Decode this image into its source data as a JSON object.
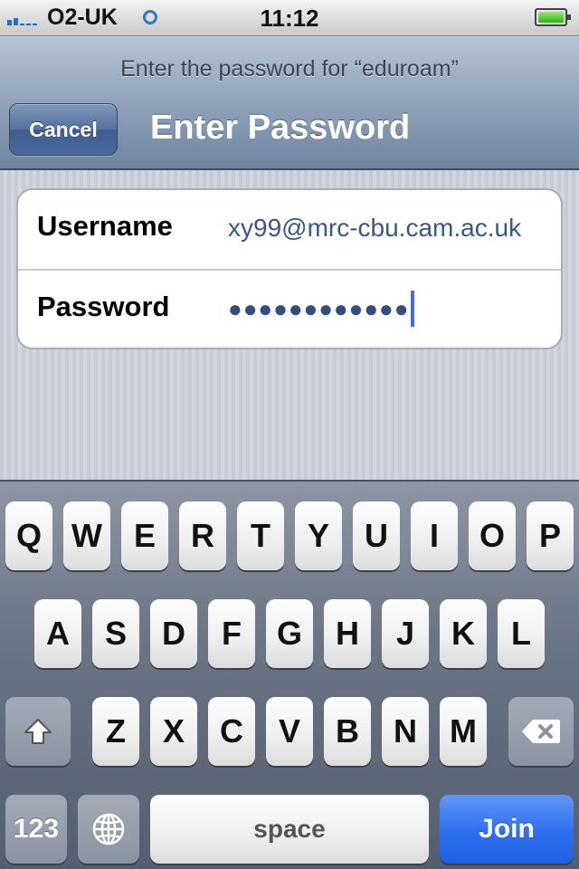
{
  "status_bar": {
    "carrier": "O2-UK",
    "time": "11:12",
    "signal_icon": "signal-bars-icon",
    "network_icon": "network-ring-icon",
    "battery_icon": "battery-icon",
    "battery_level": 1.0
  },
  "nav": {
    "prompt": "Enter the password for “eduroam”",
    "cancel_label": "Cancel",
    "title": "Enter Password"
  },
  "form": {
    "username_label": "Username",
    "username_value": "xy99@mrc-cbu.cam.ac.uk",
    "password_label": "Password",
    "password_dots": "●●●●●●●●●●●●"
  },
  "keyboard": {
    "row1": [
      "Q",
      "W",
      "E",
      "R",
      "T",
      "Y",
      "U",
      "I",
      "O",
      "P"
    ],
    "row2": [
      "A",
      "S",
      "D",
      "F",
      "G",
      "H",
      "J",
      "K",
      "L"
    ],
    "row3": [
      "Z",
      "X",
      "C",
      "V",
      "B",
      "N",
      "M"
    ],
    "numbers_label": "123",
    "space_label": "space",
    "join_label": "Join",
    "shift_icon": "shift-arrow-icon",
    "backspace_icon": "backspace-icon",
    "globe_icon": "globe-icon"
  },
  "colors": {
    "accent_blue": "#2d6ff0",
    "input_text": "#3b558a",
    "nav_bar": "#8a9cb3"
  }
}
